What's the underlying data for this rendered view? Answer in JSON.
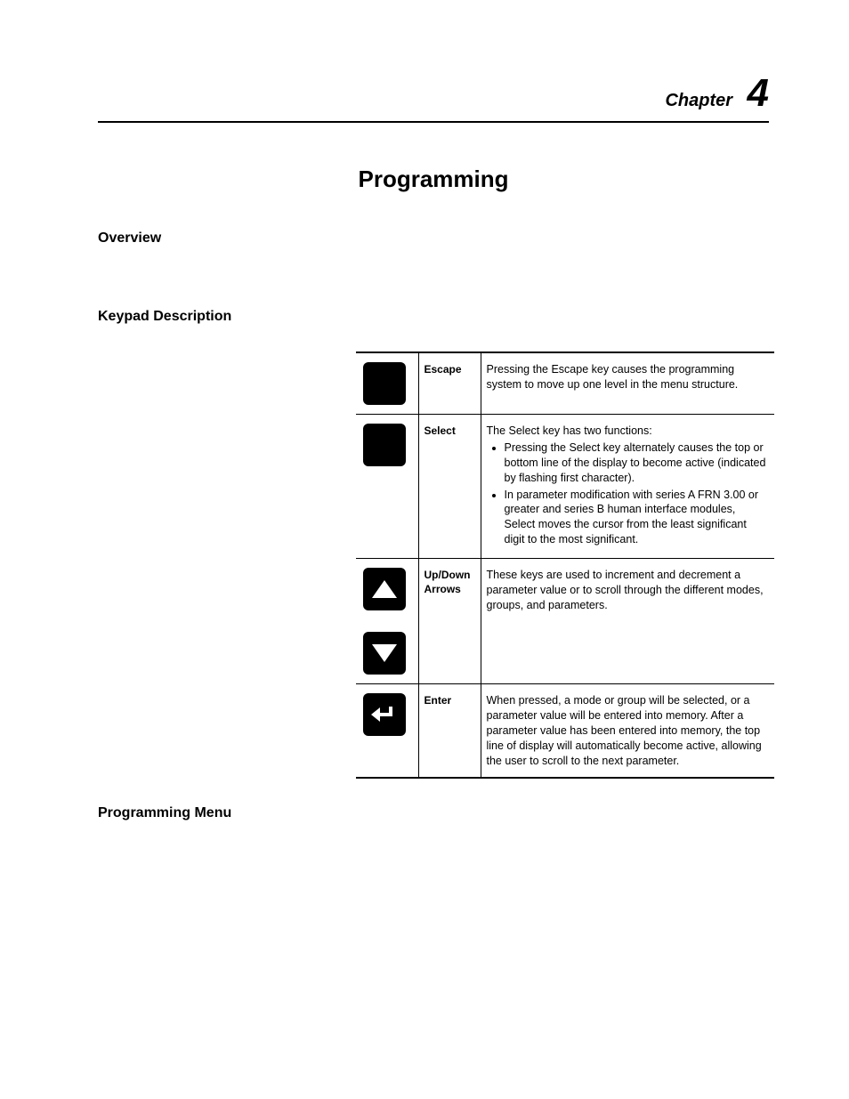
{
  "chapter": {
    "label": "Chapter",
    "number": "4"
  },
  "title": "Programming",
  "sections": {
    "overview": "Overview",
    "keypad": "Keypad Description",
    "progmenu": "Programming Menu"
  },
  "keypad": {
    "rows": [
      {
        "name": "Escape",
        "desc_intro": "Pressing the Escape key causes the programming system to move up one level in the menu structure."
      },
      {
        "name": "Select",
        "desc_intro": "The Select key has two functions:",
        "bullets": [
          "Pressing the Select key alternately causes the top or bottom line of the display to become active (indicated by flashing first character).",
          "In parameter modification with series A FRN 3.00 or greater and series B human interface modules, Select moves the cursor from the least significant digit to the most significant."
        ]
      },
      {
        "name": "Up/Down Arrows",
        "desc_intro": "These keys are used to increment and decrement a parameter value or to scroll through the different modes, groups, and parameters."
      },
      {
        "name": "Enter",
        "desc_intro": "When pressed, a mode or group will be selected, or a parameter value will be entered into memory.  After a parameter value has been entered into memory, the top line of display will automatically become active, allowing the user to scroll to the next parameter."
      }
    ]
  }
}
